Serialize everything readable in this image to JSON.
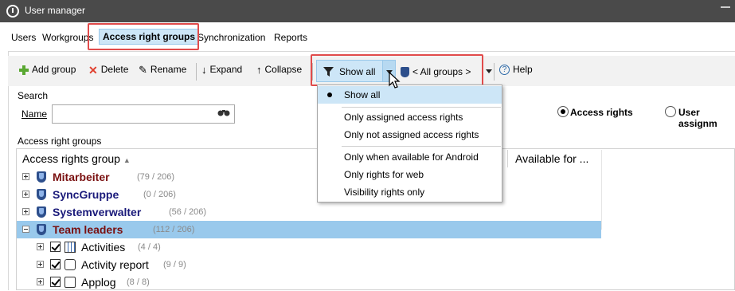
{
  "window": {
    "title": "User manager"
  },
  "menu": {
    "items": [
      "Users",
      "Workgroups",
      "Access right groups",
      "Synchronization",
      "Reports"
    ],
    "active_index": 2
  },
  "toolbar": {
    "add_group": "Add group",
    "delete": "Delete",
    "rename": "Rename",
    "expand": "Expand",
    "collapse": "Collapse",
    "show_all": "Show all",
    "groups": "< All groups >",
    "help": "Help"
  },
  "search": {
    "section_label": "Search",
    "name_label": "Name",
    "name_value": ""
  },
  "view_mode": {
    "options": [
      "Access rights",
      "User assignm"
    ],
    "selected_index": 0
  },
  "groups_section": {
    "label": "Access right groups",
    "columns": [
      "Access rights group",
      "Available for ..."
    ],
    "rows": [
      {
        "name": "Mitarbeiter",
        "count": "(79 / 206)",
        "color": "#7a1010",
        "kind": "group",
        "expanded": false
      },
      {
        "name": "SyncGruppe",
        "count": "(0 / 206)",
        "color": "#1a1a7a",
        "kind": "group",
        "expanded": false
      },
      {
        "name": "Systemverwalter",
        "count": "(56 / 206)",
        "color": "#1a1a7a",
        "kind": "group",
        "expanded": false
      },
      {
        "name": "Team leaders",
        "count": "(112 / 206)",
        "color": "#7a1010",
        "kind": "group",
        "expanded": true,
        "selected": true
      },
      {
        "name": "Activities",
        "count": "(4 / 4)",
        "kind": "item",
        "checked": true
      },
      {
        "name": "Activity report",
        "count": "(9 / 9)",
        "kind": "item",
        "checked": true
      },
      {
        "name": "Applog",
        "count": "(8 / 8)",
        "kind": "item",
        "checked": true
      }
    ]
  },
  "dropdown": {
    "items": [
      {
        "label": "Show all",
        "checked": true
      },
      {
        "label": "Only assigned access rights",
        "checked": false
      },
      {
        "label": "Only not assigned access rights",
        "checked": false
      },
      {
        "label": "Only when available for Android",
        "checked": false
      },
      {
        "label": "Only rights for web",
        "checked": false
      },
      {
        "label": "Visibility rights only",
        "checked": false
      }
    ]
  },
  "colors": {
    "highlight": "#e14b4b",
    "selection": "#99c9ec",
    "button_active": "#cde6f7"
  }
}
